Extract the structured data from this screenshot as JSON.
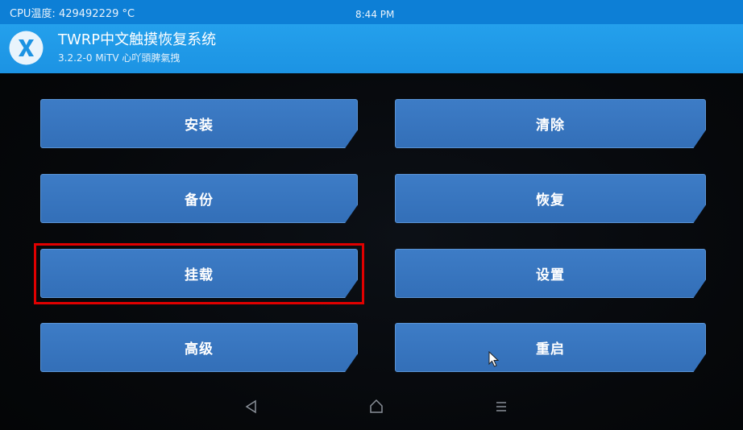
{
  "status_bar": {
    "cpu_temp": "CPU温度: 429492229 °C",
    "time": "8:44 PM"
  },
  "header": {
    "title": "TWRP中文触摸恢复系统",
    "version": "3.2.2-0 MiTV 心吖頭脾氣拽",
    "logo_icon": "twrp-logo-icon"
  },
  "menu": {
    "install": "安装",
    "wipe": "清除",
    "backup": "备份",
    "restore": "恢复",
    "mount": "挂载",
    "settings": "设置",
    "advanced": "高级",
    "reboot": "重启"
  },
  "highlight": {
    "target": "mount",
    "color": "#e00000"
  },
  "nav": {
    "back_icon": "back-icon",
    "home_icon": "home-icon",
    "menu_icon": "menu-icon"
  },
  "colors": {
    "status_bar": "#0d7fd6",
    "header": "#1c93e3",
    "button": "#3873bd",
    "background": "#06080b"
  }
}
